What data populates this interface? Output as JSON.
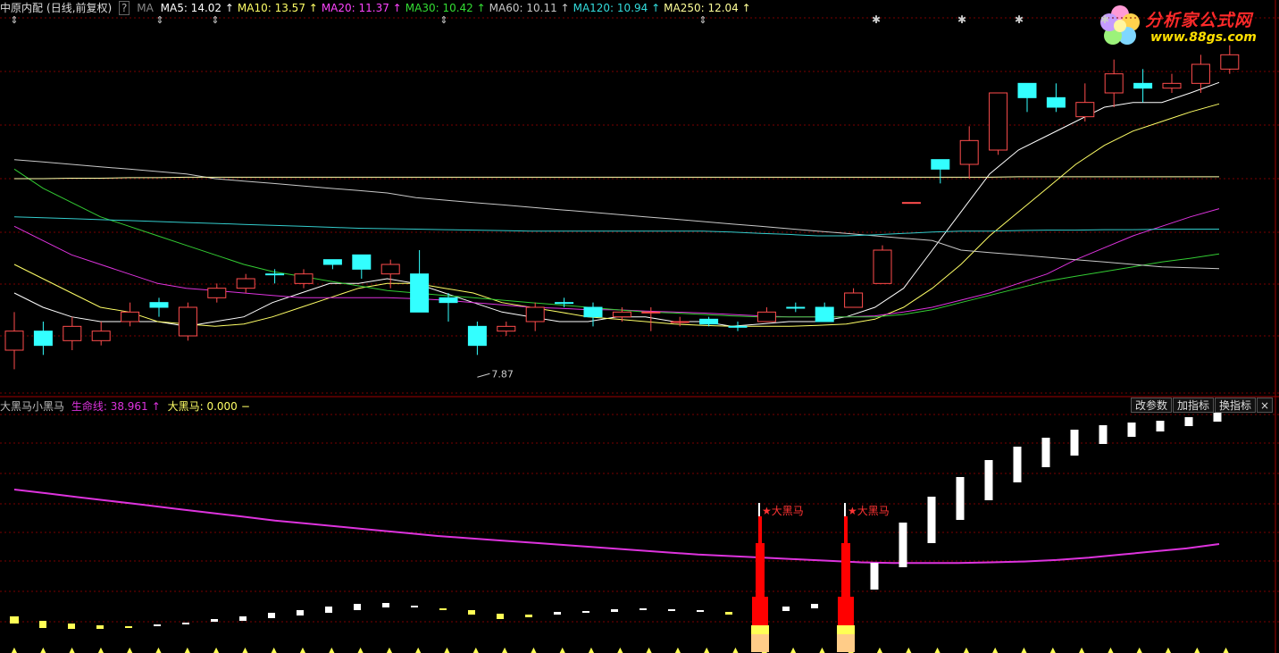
{
  "header": {
    "stock_name": "中原内配",
    "period": "(日线,前复权)",
    "help": "?",
    "indicator": "MA",
    "ma": [
      {
        "label": "MA5: 14.02",
        "arrow": "↑",
        "color": "#ffffff"
      },
      {
        "label": "MA10: 13.57",
        "arrow": "↑",
        "color": "#ffff66"
      },
      {
        "label": "MA20: 11.37",
        "arrow": "↑",
        "color": "#ff44ff"
      },
      {
        "label": "MA30: 10.42",
        "arrow": "↑",
        "color": "#33dd33"
      },
      {
        "label": "MA60: 10.11",
        "arrow": "↑",
        "color": "#c8c8c8"
      },
      {
        "label": "MA120: 10.94",
        "arrow": "↑",
        "color": "#33dddd"
      },
      {
        "label": "MA250: 12.04",
        "arrow": "↑",
        "color": "#ffff99"
      }
    ]
  },
  "logo": {
    "text": "分析家公式网",
    "url": "www.88gs.com"
  },
  "low_label": "7.87",
  "indicator_panel": {
    "name": "大黑马小黑马",
    "line_label": "生命线: 38.961",
    "line_arrow": "↑",
    "signal_label": "大黑马: 0.000",
    "signal_arrow": "−",
    "buttons": [
      "改参数",
      "加指标",
      "换指标"
    ],
    "close": "×",
    "signal_text": "★大黑马"
  },
  "colors": {
    "up": "#ff4d4d",
    "down": "#33ffff",
    "grid": "#7a0000",
    "lifeline": "#dd33dd",
    "signal_red": "#ff0000",
    "signal_yellow": "#ffff55",
    "signal_peach": "#ffcc88"
  },
  "chart_data": {
    "type": "candlestick",
    "candles": [
      {
        "o": 8.4,
        "c": 8.8,
        "h": 9.2,
        "l": 8.0,
        "up": true
      },
      {
        "o": 8.8,
        "c": 8.5,
        "h": 9.0,
        "l": 8.3,
        "up": false
      },
      {
        "o": 8.6,
        "c": 8.9,
        "h": 9.1,
        "l": 8.4,
        "up": true
      },
      {
        "o": 8.8,
        "c": 8.6,
        "h": 9.0,
        "l": 8.5,
        "up": true
      },
      {
        "o": 9.0,
        "c": 9.2,
        "h": 9.4,
        "l": 8.9,
        "up": true
      },
      {
        "o": 9.4,
        "c": 9.3,
        "h": 9.5,
        "l": 9.1,
        "up": false
      },
      {
        "o": 8.7,
        "c": 9.3,
        "h": 9.4,
        "l": 8.6,
        "up": true
      },
      {
        "o": 9.5,
        "c": 9.7,
        "h": 9.8,
        "l": 9.4,
        "up": true
      },
      {
        "o": 9.7,
        "c": 9.9,
        "h": 10.0,
        "l": 9.6,
        "up": true
      },
      {
        "o": 10.0,
        "c": 10.0,
        "h": 10.1,
        "l": 9.8,
        "up": false
      },
      {
        "o": 9.8,
        "c": 10.0,
        "h": 10.1,
        "l": 9.7,
        "up": true
      },
      {
        "o": 10.3,
        "c": 10.2,
        "h": 10.3,
        "l": 10.1,
        "up": false
      },
      {
        "o": 10.4,
        "c": 10.1,
        "h": 10.4,
        "l": 9.9,
        "up": false
      },
      {
        "o": 10.0,
        "c": 10.2,
        "h": 10.3,
        "l": 9.7,
        "up": true
      },
      {
        "o": 10.0,
        "c": 9.2,
        "h": 10.5,
        "l": 9.2,
        "up": false
      },
      {
        "o": 9.5,
        "c": 9.4,
        "h": 9.6,
        "l": 9.0,
        "up": false
      },
      {
        "o": 8.9,
        "c": 8.5,
        "h": 9.0,
        "l": 8.3,
        "up": false
      },
      {
        "o": 8.8,
        "c": 8.9,
        "h": 9.0,
        "l": 8.7,
        "up": true
      },
      {
        "o": 9.0,
        "c": 9.3,
        "h": 9.4,
        "l": 8.8,
        "up": true
      },
      {
        "o": 9.4,
        "c": 9.4,
        "h": 9.5,
        "l": 9.3,
        "up": false
      },
      {
        "o": 9.3,
        "c": 9.1,
        "h": 9.4,
        "l": 8.9,
        "up": false
      },
      {
        "o": 9.1,
        "c": 9.2,
        "h": 9.3,
        "l": 9.0,
        "up": true
      },
      {
        "o": 9.2,
        "c": 9.2,
        "h": 9.3,
        "l": 8.8,
        "up": true
      },
      {
        "o": 9.0,
        "c": 9.0,
        "h": 9.1,
        "l": 8.9,
        "up": true
      },
      {
        "o": 9.05,
        "c": 8.95,
        "h": 9.1,
        "l": 8.9,
        "up": false
      },
      {
        "o": 8.9,
        "c": 8.9,
        "h": 9.0,
        "l": 8.8,
        "up": false
      },
      {
        "o": 9.0,
        "c": 9.2,
        "h": 9.3,
        "l": 9.0,
        "up": true
      },
      {
        "o": 9.3,
        "c": 9.3,
        "h": 9.4,
        "l": 9.2,
        "up": false
      },
      {
        "o": 9.3,
        "c": 9.0,
        "h": 9.4,
        "l": 9.0,
        "up": false
      },
      {
        "o": 9.3,
        "c": 9.6,
        "h": 9.7,
        "l": 9.3,
        "up": true
      },
      {
        "o": 9.8,
        "c": 10.5,
        "h": 10.6,
        "l": 9.8,
        "up": true
      },
      {
        "o": 11.5,
        "c": 11.5,
        "h": 11.5,
        "l": 11.5,
        "up": true
      },
      {
        "o": 12.4,
        "c": 12.2,
        "h": 12.4,
        "l": 11.9,
        "up": false
      },
      {
        "o": 12.3,
        "c": 12.8,
        "h": 13.1,
        "l": 12.0,
        "up": true
      },
      {
        "o": 12.6,
        "c": 13.8,
        "h": 13.8,
        "l": 12.5,
        "up": true
      },
      {
        "o": 14.0,
        "c": 13.7,
        "h": 14.0,
        "l": 13.4,
        "up": false
      },
      {
        "o": 13.7,
        "c": 13.5,
        "h": 14.0,
        "l": 13.4,
        "up": false
      },
      {
        "o": 13.3,
        "c": 13.6,
        "h": 14.0,
        "l": 13.2,
        "up": true
      },
      {
        "o": 13.8,
        "c": 14.2,
        "h": 14.5,
        "l": 13.5,
        "up": true
      },
      {
        "o": 14.0,
        "c": 13.9,
        "h": 14.3,
        "l": 13.6,
        "up": false
      },
      {
        "o": 13.9,
        "c": 14.0,
        "h": 14.2,
        "l": 13.8,
        "up": true
      },
      {
        "o": 14.0,
        "c": 14.4,
        "h": 14.6,
        "l": 13.8,
        "up": true
      },
      {
        "o": 14.3,
        "c": 14.6,
        "h": 14.8,
        "l": 14.2,
        "up": true
      }
    ],
    "ma_lines": {
      "MA5": [
        9.6,
        9.3,
        9.1,
        9.0,
        9.0,
        9.0,
        8.9,
        9.0,
        9.1,
        9.4,
        9.6,
        9.8,
        9.8,
        9.9,
        9.8,
        9.6,
        9.4,
        9.2,
        9.1,
        9.0,
        9.0,
        9.1,
        9.1,
        9.0,
        9.0,
        8.9,
        8.95,
        9.0,
        9.0,
        9.1,
        9.3,
        9.7,
        10.5,
        11.3,
        12.1,
        12.6,
        12.9,
        13.2,
        13.5,
        13.6,
        13.6,
        13.8,
        14.02
      ],
      "MA10": [
        10.2,
        9.9,
        9.6,
        9.3,
        9.2,
        9.0,
        8.95,
        8.9,
        8.95,
        9.1,
        9.3,
        9.5,
        9.7,
        9.8,
        9.8,
        9.7,
        9.6,
        9.4,
        9.3,
        9.2,
        9.1,
        9.05,
        9.0,
        8.95,
        8.92,
        8.9,
        8.9,
        8.9,
        8.92,
        8.95,
        9.05,
        9.3,
        9.7,
        10.2,
        10.8,
        11.3,
        11.8,
        12.3,
        12.7,
        13.0,
        13.2,
        13.4,
        13.57
      ],
      "MA20": [
        11.0,
        10.7,
        10.4,
        10.2,
        10.0,
        9.8,
        9.7,
        9.65,
        9.6,
        9.55,
        9.5,
        9.5,
        9.5,
        9.5,
        9.48,
        9.45,
        9.4,
        9.35,
        9.3,
        9.28,
        9.25,
        9.25,
        9.22,
        9.2,
        9.18,
        9.15,
        9.12,
        9.1,
        9.1,
        9.1,
        9.12,
        9.2,
        9.3,
        9.45,
        9.6,
        9.8,
        10.0,
        10.3,
        10.55,
        10.8,
        11.0,
        11.2,
        11.37
      ],
      "MA30": [
        12.2,
        11.8,
        11.5,
        11.2,
        11.0,
        10.8,
        10.6,
        10.4,
        10.2,
        10.05,
        9.95,
        9.85,
        9.75,
        9.65,
        9.6,
        9.55,
        9.5,
        9.45,
        9.4,
        9.35,
        9.3,
        9.25,
        9.2,
        9.18,
        9.15,
        9.12,
        9.1,
        9.1,
        9.1,
        9.1,
        9.1,
        9.15,
        9.25,
        9.4,
        9.55,
        9.7,
        9.85,
        9.95,
        10.05,
        10.15,
        10.25,
        10.33,
        10.42
      ],
      "MA60": [
        12.4,
        12.35,
        12.3,
        12.25,
        12.2,
        12.15,
        12.1,
        12.0,
        11.95,
        11.9,
        11.85,
        11.8,
        11.75,
        11.7,
        11.6,
        11.55,
        11.5,
        11.45,
        11.4,
        11.35,
        11.3,
        11.25,
        11.2,
        11.15,
        11.1,
        11.05,
        11.0,
        10.95,
        10.9,
        10.85,
        10.8,
        10.75,
        10.7,
        10.5,
        10.45,
        10.4,
        10.35,
        10.3,
        10.25,
        10.2,
        10.15,
        10.13,
        10.11
      ],
      "MA120": [
        11.2,
        11.18,
        11.16,
        11.14,
        11.12,
        11.1,
        11.08,
        11.06,
        11.04,
        11.02,
        11.0,
        10.98,
        10.96,
        10.95,
        10.94,
        10.93,
        10.92,
        10.91,
        10.9,
        10.9,
        10.9,
        10.9,
        10.9,
        10.9,
        10.9,
        10.88,
        10.85,
        10.83,
        10.8,
        10.8,
        10.82,
        10.85,
        10.88,
        10.9,
        10.9,
        10.91,
        10.92,
        10.92,
        10.93,
        10.93,
        10.94,
        10.94,
        10.94
      ],
      "MA250": [
        12.0,
        12.0,
        12.01,
        12.01,
        12.02,
        12.02,
        12.03,
        12.03,
        12.03,
        12.03,
        12.03,
        12.03,
        12.03,
        12.03,
        12.03,
        12.03,
        12.03,
        12.03,
        12.03,
        12.03,
        12.03,
        12.03,
        12.03,
        12.03,
        12.03,
        12.03,
        12.03,
        12.03,
        12.03,
        12.03,
        12.03,
        12.03,
        12.03,
        12.03,
        12.03,
        12.04,
        12.04,
        12.04,
        12.04,
        12.04,
        12.04,
        12.04,
        12.04
      ]
    },
    "lifeline": [
      46.0,
      45.5,
      45.0,
      44.5,
      44.0,
      43.5,
      43.0,
      42.5,
      42.0,
      41.6,
      41.2,
      40.8,
      40.4,
      40.0,
      39.7,
      39.4,
      39.1,
      38.8,
      38.5,
      38.2,
      37.9,
      37.6,
      37.4,
      37.2,
      37.0,
      36.8,
      36.6,
      36.5,
      36.5,
      36.5,
      36.6,
      36.7,
      36.9,
      37.2,
      37.6,
      38.0,
      38.4,
      38.961
    ],
    "signals": [
      26,
      29
    ]
  }
}
